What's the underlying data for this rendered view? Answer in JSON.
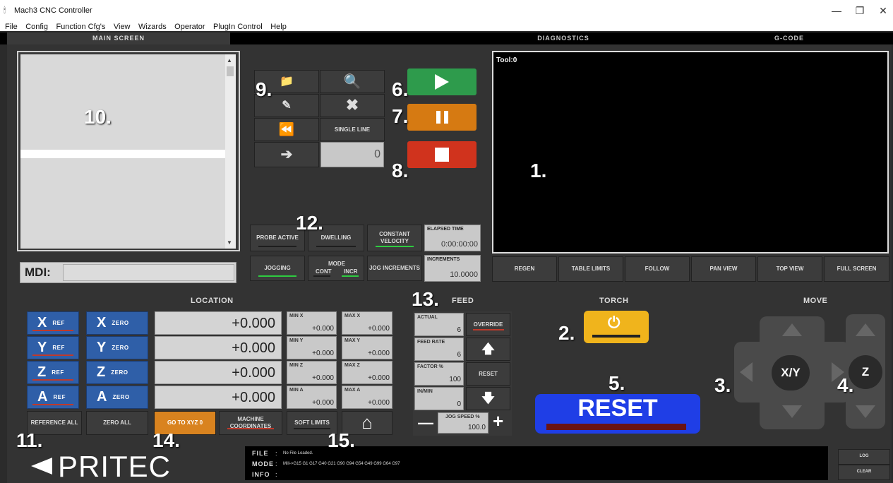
{
  "window": {
    "title": "Mach3 CNC Controller",
    "minimize": "—",
    "restore": "❐",
    "close": "✕"
  },
  "menu": [
    "File",
    "Config",
    "Function Cfg's",
    "View",
    "Wizards",
    "Operator",
    "PlugIn Control",
    "Help"
  ],
  "tabs": [
    "MAIN SCREEN",
    "DIAGNOSTICS",
    "G-CODE"
  ],
  "annotations": [
    "1.",
    "2.",
    "3.",
    "4.",
    "5.",
    "6.",
    "7.",
    "8.",
    "9.",
    "10.",
    "11.",
    "12.",
    "13.",
    "14.",
    "15."
  ],
  "toolpath": {
    "tool_label": "Tool:0"
  },
  "gcode_panel": {
    "line_number": "0",
    "single_line": "SINGLE LINE"
  },
  "mdi": {
    "label": "MDI:",
    "value": ""
  },
  "status_leds": {
    "probe_active": "PROBE ACTIVE",
    "dwelling": "DWELLING",
    "constant_velocity": "CONSTANT VELOCITY",
    "elapsed_time_label": "ELAPSED TIME",
    "elapsed_time": "0:00:00:00",
    "jogging": "JOGGING",
    "mode_label": "MODE",
    "mode_cont": "CONT",
    "mode_incr": "INCR",
    "jog_increments": "JOG INCREMENTS",
    "increments_label": "INCREMENTS",
    "increments_value": "10.0000"
  },
  "view_buttons": [
    "REGEN",
    "TABLE LIMITS",
    "FOLLOW",
    "PAN VIEW",
    "TOP VIEW",
    "FULL SCREEN"
  ],
  "location": {
    "title": "LOCATION",
    "ref_label": "REF",
    "zero_label": "ZERO",
    "axes": [
      "X",
      "Y",
      "Z",
      "A"
    ],
    "values": [
      "+0.000",
      "+0.000",
      "+0.000",
      "+0.000"
    ],
    "min_labels": [
      "MIN X",
      "MIN Y",
      "MIN Z",
      "MIN A"
    ],
    "max_labels": [
      "MAX X",
      "MAX Y",
      "MAX Z",
      "MAX A"
    ],
    "min_values": [
      "+0.000",
      "+0.000",
      "+0.000",
      "+0.000"
    ],
    "max_values": [
      "+0.000",
      "+0.000",
      "+0.000",
      "+0.000"
    ],
    "reference_all": "REFERENCE ALL",
    "zero_all": "ZERO ALL",
    "goto_xyz0": "GO TO XYZ 0",
    "machine_coordinates": "MACHINE COORDINATES",
    "soft_limits": "SOFT LIMITS"
  },
  "feed": {
    "title": "FEED",
    "actual_label": "ACTUAL",
    "actual_value": "6",
    "feed_rate_label": "FEED RATE",
    "feed_rate_value": "6",
    "factor_label": "FACTOR %",
    "factor_value": "100",
    "in_min_label": "IN/MIN",
    "in_min_value": "0",
    "override": "OVERRIDE",
    "reset": "RESET",
    "jog_speed_label": "JOG SPEED %",
    "jog_speed_value": "100.0"
  },
  "torch": {
    "title": "TORCH"
  },
  "move": {
    "title": "MOVE",
    "xy": "X/Y",
    "z": "Z"
  },
  "reset_button": "RESET",
  "info_bar": {
    "file_label": "FILE",
    "file_value": "No File Loaded.",
    "mode_label": "MODE",
    "mode_value": "Mill->G15  G1 G17 G40 G21 G90 G94 G54 G49 G99 G64 G97",
    "info_label": "INFO",
    "info_value": ""
  },
  "log_buttons": {
    "log": "LOG",
    "clear": "CLEAR"
  },
  "logo": "PRITEC",
  "colors": {
    "play": "#2e9b4c",
    "pause": "#d67a12",
    "stop": "#d0331d",
    "torch": "#f0b41c",
    "reset": "#1f3ee6",
    "axis_blue": "#2f5fa8",
    "goto_orange": "#d9831f"
  }
}
